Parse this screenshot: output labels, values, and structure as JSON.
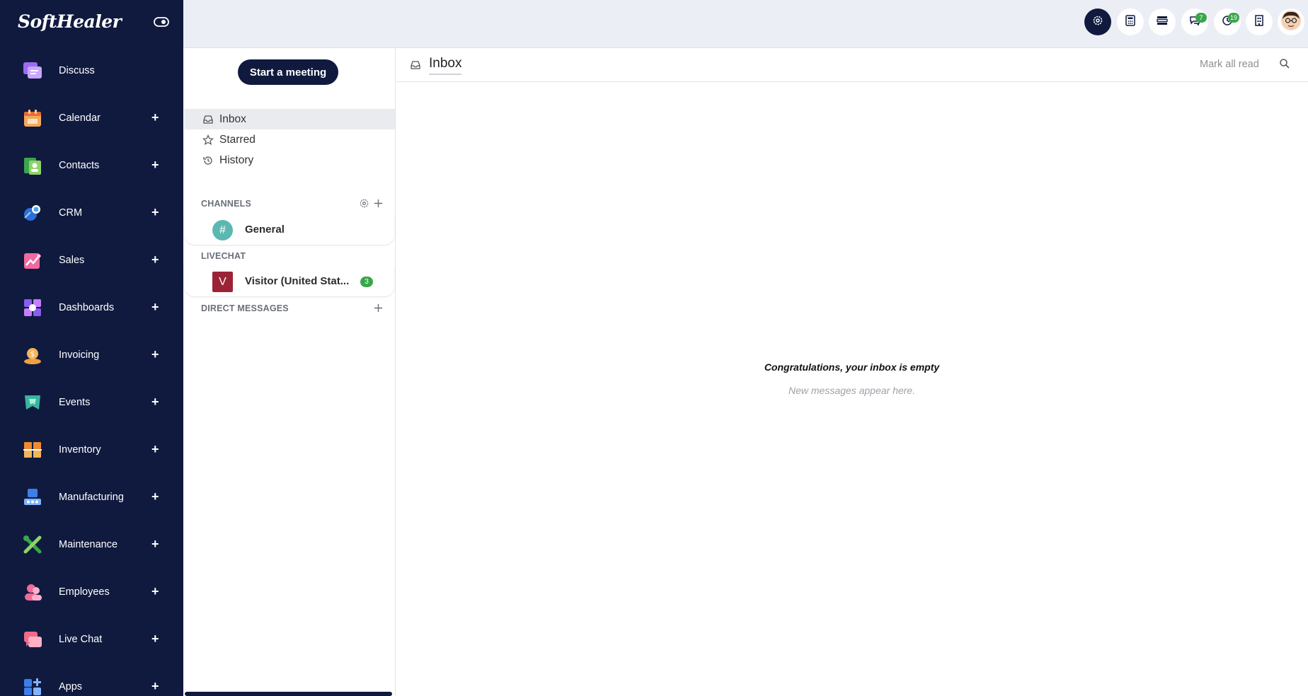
{
  "brand": {
    "name": "SoftHealer"
  },
  "apps": [
    {
      "label": "Discuss",
      "icon": "discuss-icon",
      "has_plus": false
    },
    {
      "label": "Calendar",
      "icon": "calendar-icon",
      "has_plus": true
    },
    {
      "label": "Contacts",
      "icon": "contacts-icon",
      "has_plus": true
    },
    {
      "label": "CRM",
      "icon": "crm-icon",
      "has_plus": true
    },
    {
      "label": "Sales",
      "icon": "sales-icon",
      "has_plus": true
    },
    {
      "label": "Dashboards",
      "icon": "dashboards-icon",
      "has_plus": true
    },
    {
      "label": "Invoicing",
      "icon": "invoicing-icon",
      "has_plus": true
    },
    {
      "label": "Events",
      "icon": "events-icon",
      "has_plus": true
    },
    {
      "label": "Inventory",
      "icon": "inventory-icon",
      "has_plus": true
    },
    {
      "label": "Manufacturing",
      "icon": "manufacturing-icon",
      "has_plus": true
    },
    {
      "label": "Maintenance",
      "icon": "maintenance-icon",
      "has_plus": true
    },
    {
      "label": "Employees",
      "icon": "employees-icon",
      "has_plus": true
    },
    {
      "label": "Live Chat",
      "icon": "livechat-icon",
      "has_plus": true
    },
    {
      "label": "Apps",
      "icon": "apps-icon",
      "has_plus": true
    }
  ],
  "plus_glyph": "+",
  "topbar": {
    "buttons": [
      {
        "icon": "settings-icon",
        "badge": ""
      },
      {
        "icon": "calculator-icon",
        "badge": ""
      },
      {
        "icon": "layout-icon",
        "badge": ""
      },
      {
        "icon": "messages-icon",
        "badge": "7"
      },
      {
        "icon": "activity-icon",
        "badge": "19"
      },
      {
        "icon": "company-icon",
        "badge": ""
      },
      {
        "icon": "user-avatar-icon",
        "badge": ""
      }
    ]
  },
  "discuss": {
    "start_meeting": "Start a meeting",
    "mailboxes": [
      {
        "label": "Inbox",
        "active": true
      },
      {
        "label": "Starred",
        "active": false
      },
      {
        "label": "History",
        "active": false
      }
    ],
    "channels_header": "CHANNELS",
    "channels": [
      {
        "name": "General",
        "avatar": "#"
      }
    ],
    "livechat_header": "LIVECHAT",
    "livechats": [
      {
        "name": "Visitor (United Stat...",
        "avatar": "V",
        "counter": "3"
      }
    ],
    "dm_header": "DIRECT MESSAGES"
  },
  "thread": {
    "title": "Inbox",
    "mark_all_read": "Mark all read",
    "empty_title": "Congratulations, your inbox is empty",
    "empty_subtitle": "New messages appear here."
  },
  "colors": {
    "sidebar_bg": "#101a3f",
    "topbar_bg": "#eceef5",
    "badge_green": "#3aa64b",
    "general_avatar": "#5ab8b1",
    "visitor_avatar": "#9b2335"
  }
}
